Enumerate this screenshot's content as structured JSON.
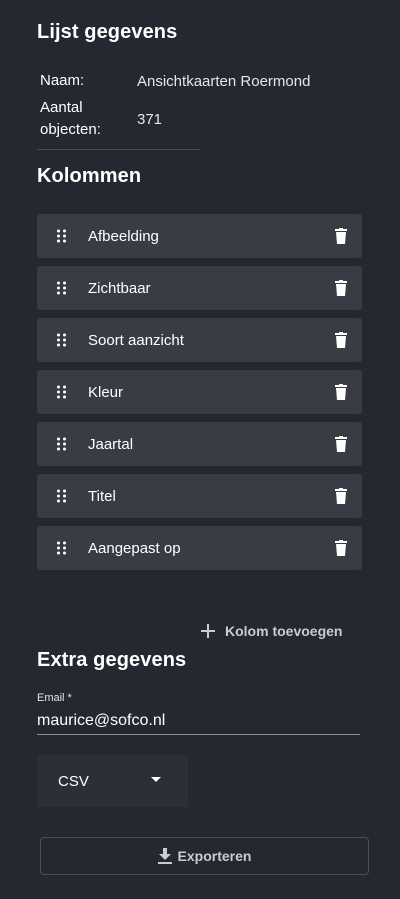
{
  "list_section": {
    "title": "Lijst gegevens",
    "name_label": "Naam:",
    "name_value": "Ansichtkaarten Roermond",
    "count_label_line1": "Aantal",
    "count_label_line2": "objecten:",
    "count_value": "371"
  },
  "columns_section": {
    "title": "Kolommen",
    "items": [
      {
        "label": "Afbeelding"
      },
      {
        "label": "Zichtbaar"
      },
      {
        "label": "Soort aanzicht"
      },
      {
        "label": "Kleur"
      },
      {
        "label": "Jaartal"
      },
      {
        "label": "Titel"
      },
      {
        "label": "Aangepast op"
      }
    ],
    "add_label": "Kolom toevoegen",
    "drag_icon": "drag-handle-icon",
    "delete_icon": "trash-icon"
  },
  "extra_section": {
    "title": "Extra gegevens",
    "email_label": "Email *",
    "email_value": "maurice@sofco.nl",
    "format_value": "CSV"
  },
  "export": {
    "label": "Exporteren",
    "icon": "download-icon"
  },
  "colors": {
    "background": "#252830",
    "card": "#393c44",
    "muted_text": "#c8ccd4"
  }
}
